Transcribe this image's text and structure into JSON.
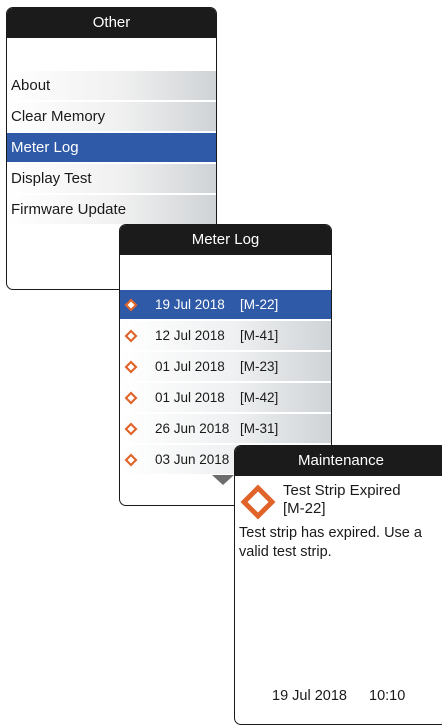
{
  "other_screen": {
    "title": "Other",
    "items": [
      {
        "label": "About",
        "selected": false
      },
      {
        "label": "Clear Memory",
        "selected": false
      },
      {
        "label": "Meter Log",
        "selected": true
      },
      {
        "label": "Display Test",
        "selected": false
      },
      {
        "label": "Firmware Update",
        "selected": false
      }
    ]
  },
  "meter_log_screen": {
    "title": "Meter Log",
    "entries": [
      {
        "date": "19 Jul 2018",
        "code": "[M-22]",
        "selected": true
      },
      {
        "date": "12 Jul 2018",
        "code": "[M-41]",
        "selected": false
      },
      {
        "date": "01 Jul 2018",
        "code": "[M-23]",
        "selected": false
      },
      {
        "date": "01 Jul 2018",
        "code": "[M-42]",
        "selected": false
      },
      {
        "date": "26 Jun 2018",
        "code": "[M-31]",
        "selected": false
      },
      {
        "date": "03 Jun 2018",
        "code": "",
        "selected": false
      }
    ],
    "scroll_icon": "triangle-down-icon"
  },
  "maintenance_screen": {
    "title": "Maintenance",
    "icon": "warning-diamond-icon",
    "message_title_line1": "Test Strip Expired",
    "message_title_line2": "[M-22]",
    "body": "Test strip has expired. Use a valid test strip.",
    "date": "19 Jul 2018",
    "time": "10:10"
  },
  "colors": {
    "header_bg": "#1b1b1b",
    "selected_bg": "#2f5aa7",
    "diamond_orange": "#e0632a",
    "item_gradient_end": "#cfd3d6"
  }
}
